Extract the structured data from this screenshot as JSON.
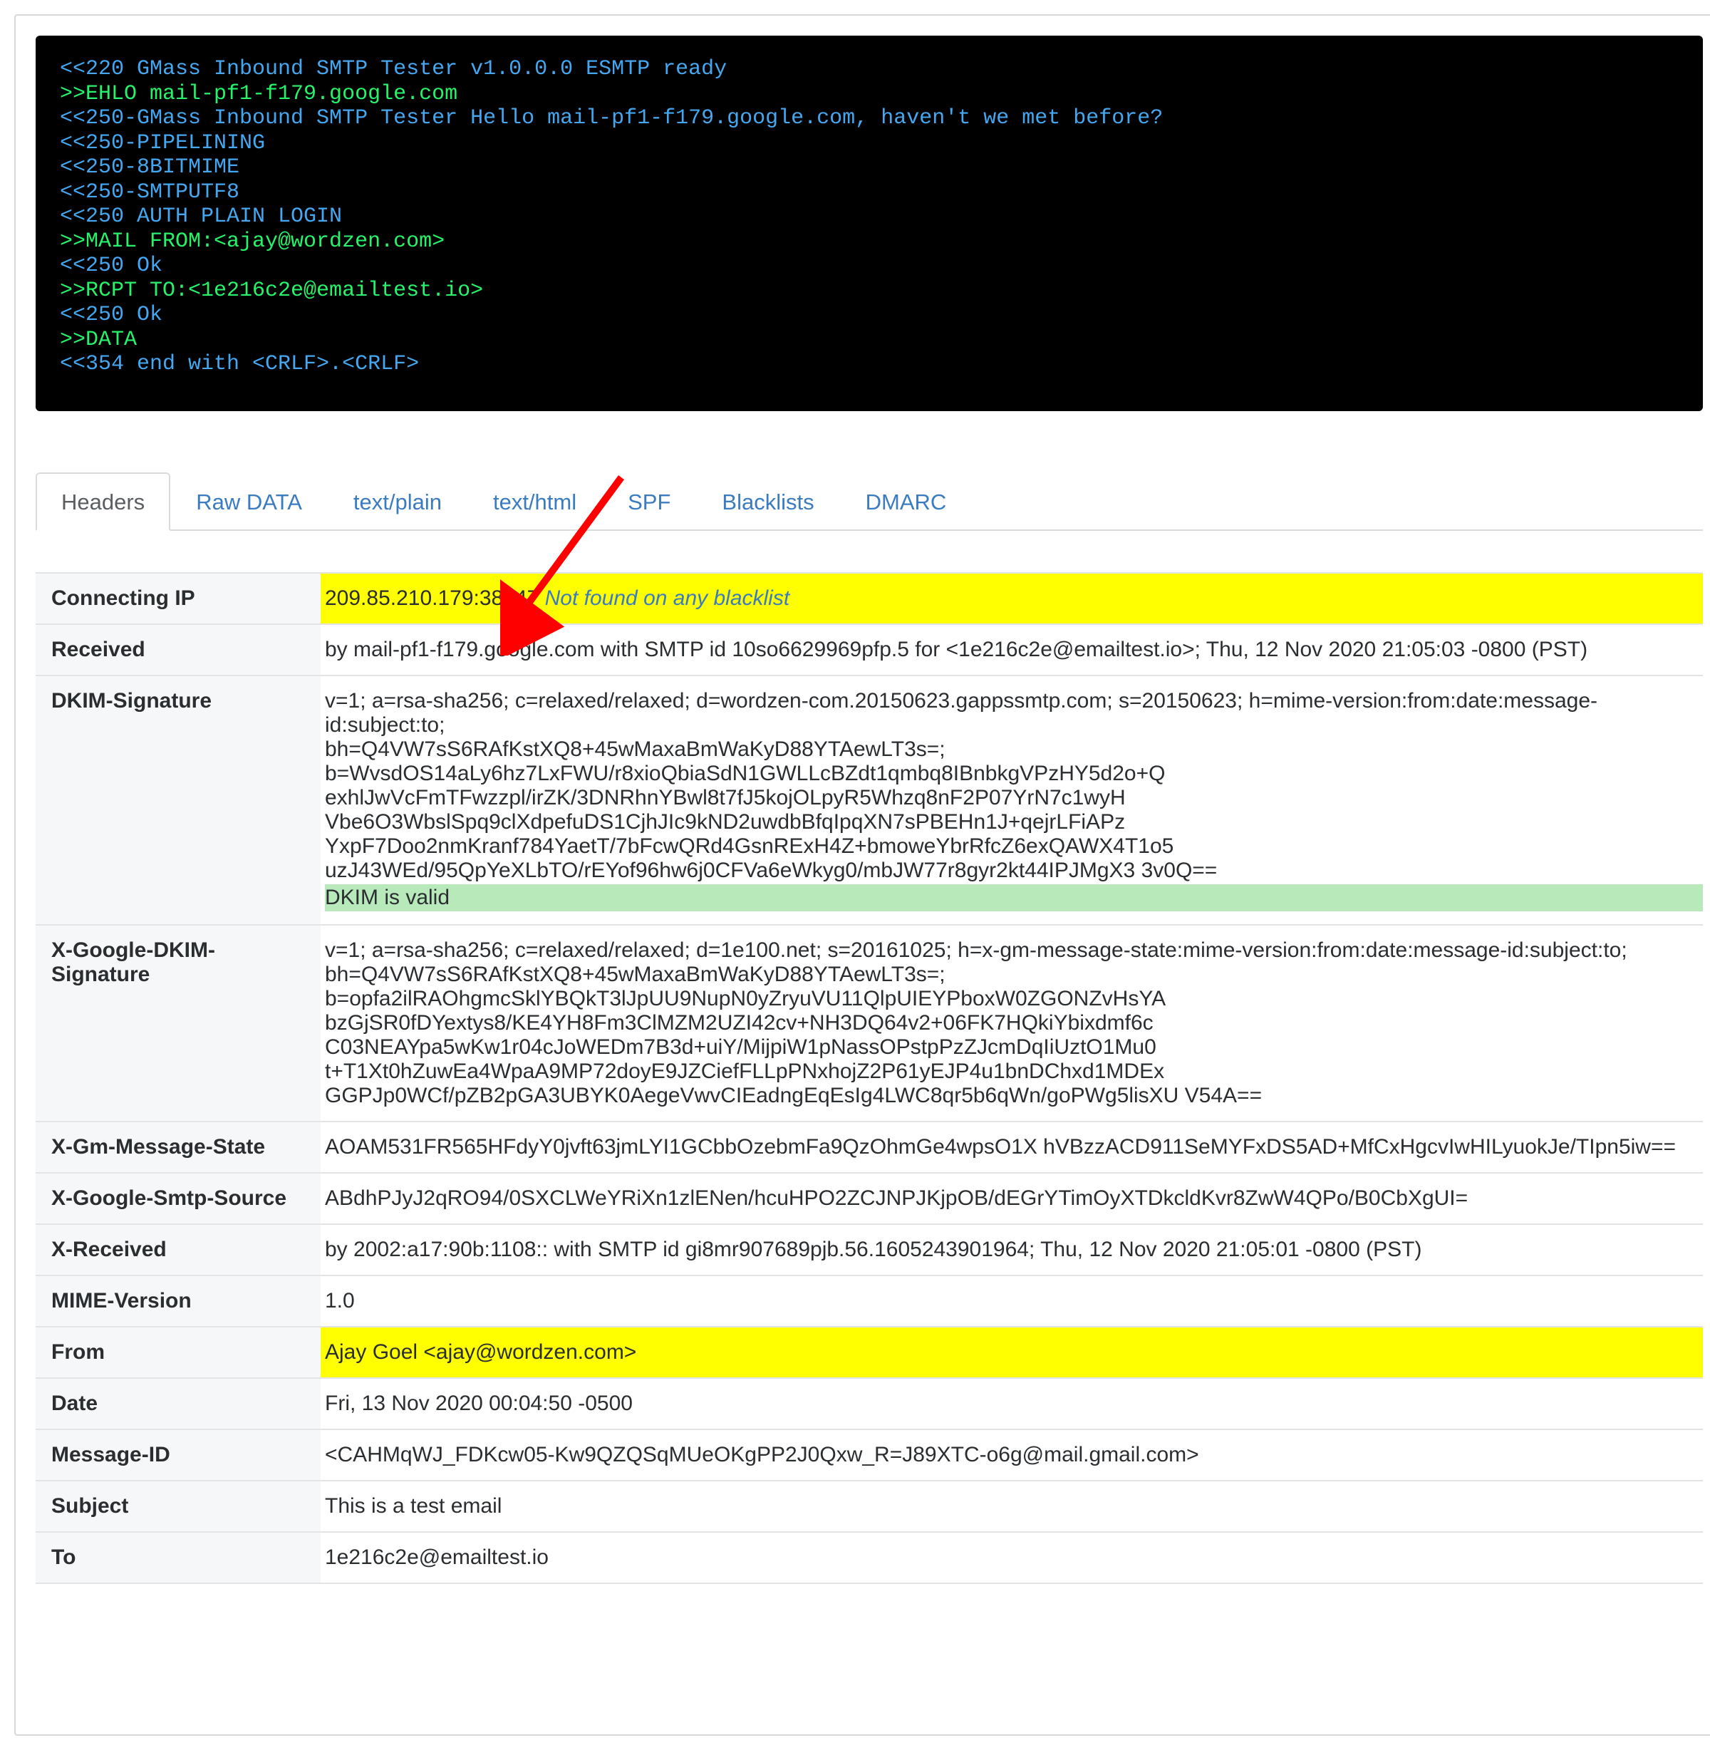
{
  "terminal": {
    "lines": [
      {
        "cls": "c",
        "text": "<<220 GMass Inbound SMTP Tester v1.0.0.0 ESMTP ready"
      },
      {
        "cls": "g",
        "text": ">>EHLO mail-pf1-f179.google.com"
      },
      {
        "cls": "c",
        "text": "<<250-GMass Inbound SMTP Tester Hello mail-pf1-f179.google.com, haven't we met before?"
      },
      {
        "cls": "c",
        "text": "<<250-PIPELINING"
      },
      {
        "cls": "c",
        "text": "<<250-8BITMIME"
      },
      {
        "cls": "c",
        "text": "<<250-SMTPUTF8"
      },
      {
        "cls": "c",
        "text": "<<250 AUTH PLAIN LOGIN"
      },
      {
        "cls": "g",
        "text": ">>MAIL FROM:<ajay@wordzen.com>"
      },
      {
        "cls": "c",
        "text": "<<250 Ok"
      },
      {
        "cls": "g",
        "text": ">>RCPT TO:<1e216c2e@emailtest.io>"
      },
      {
        "cls": "c",
        "text": "<<250 Ok"
      },
      {
        "cls": "g",
        "text": ">>DATA"
      },
      {
        "cls": "c",
        "text": "<<354 end with <CRLF>.<CRLF>"
      }
    ]
  },
  "tabs": {
    "items": [
      {
        "label": "Headers",
        "active": true
      },
      {
        "label": "Raw DATA",
        "active": false
      },
      {
        "label": "text/plain",
        "active": false
      },
      {
        "label": "text/html",
        "active": false
      },
      {
        "label": "SPF",
        "active": false
      },
      {
        "label": "Blacklists",
        "active": false
      },
      {
        "label": "DMARC",
        "active": false
      }
    ]
  },
  "headers": {
    "connecting_ip": {
      "label": "Connecting IP",
      "value": "209.85.210.179:38647",
      "note": "Not found on any blacklist"
    },
    "received": {
      "label": "Received",
      "value": "by mail-pf1-f179.google.com with SMTP id 10so6629969pfp.5 for <1e216c2e@emailtest.io>; Thu, 12 Nov 2020 21:05:03 -0800 (PST)"
    },
    "dkim_signature": {
      "label": "DKIM-Signature",
      "l1": "v=1; a=rsa-sha256; c=relaxed/relaxed; d=wordzen-com.20150623.gappssmtp.com; s=20150623; h=mime-version:from:date:message-id:subject:to;",
      "l2": "bh=Q4VW7sS6RAfKstXQ8+45wMaxaBmWaKyD88YTAewLT3s=;",
      "l3": "b=WvsdOS14aLy6hz7LxFWU/r8xioQbiaSdN1GWLLcBZdt1qmbq8IBnbkgVPzHY5d2o+Q",
      "l4": "exhlJwVcFmTFwzzpl/irZK/3DNRhnYBwl8t7fJ5kojOLpyR5Whzq8nF2P07YrN7c1wyH",
      "l5": "Vbe6O3WbslSpq9clXdpefuDS1CjhJIc9kND2uwdbBfqIpqXN7sPBEHn1J+qejrLFiAPz",
      "l6": "YxpF7Doo2nmKranf784YaetT/7bFcwQRd4GsnRExH4Z+bmoweYbrRfcZ6exQAWX4T1o5",
      "l7": "uzJ43WEd/95QpYeXLbTO/rEYof96hw6j0CFVa6eWkyg0/mbJW77r8gyr2kt44IPJMgX3 3v0Q==",
      "valid": "DKIM is valid"
    },
    "x_google_dkim": {
      "label": "X-Google-DKIM-Signature",
      "l1": "v=1; a=rsa-sha256; c=relaxed/relaxed; d=1e100.net; s=20161025; h=x-gm-message-state:mime-version:from:date:message-id:subject:to;",
      "l2": "bh=Q4VW7sS6RAfKstXQ8+45wMaxaBmWaKyD88YTAewLT3s=;",
      "l3": "b=opfa2ilRAOhgmcSklYBQkT3lJpUU9NupN0yZryuVU11QlpUIEYPboxW0ZGONZvHsYA",
      "l4": "bzGjSR0fDYextys8/KE4YH8Fm3ClMZM2UZI42cv+NH3DQ64v2+06FK7HQkiYbixdmf6c",
      "l5": "C03NEAYpa5wKw1r04cJoWEDm7B3d+uiY/MijpiW1pNassOPstpPzZJcmDqIiUztO1Mu0",
      "l6": "t+T1Xt0hZuwEa4WpaA9MP72doyE9JZCiefFLLpPNxhojZ2P61yEJP4u1bnDChxd1MDEx",
      "l7": "GGPJp0WCf/pZB2pGA3UBYK0AegeVwvCIEadngEqEsIg4LWC8qr5b6qWn/goPWg5lisXU V54A=="
    },
    "x_gm_message_state": {
      "label": "X-Gm-Message-State",
      "value": "AOAM531FR565HFdyY0jvft63jmLYI1GCbbOzebmFa9QzOhmGe4wpsO1X hVBzzACD911SeMYFxDS5AD+MfCxHgcvIwHILyuokJe/TIpn5iw=="
    },
    "x_google_smtp_source": {
      "label": "X-Google-Smtp-Source",
      "value": "ABdhPJyJ2qRO94/0SXCLWeYRiXn1zlENen/hcuHPO2ZCJNPJKjpOB/dEGrYTimOyXTDkcldKvr8ZwW4QPo/B0CbXgUI="
    },
    "x_received": {
      "label": "X-Received",
      "value": "by 2002:a17:90b:1108:: with SMTP id gi8mr907689pjb.56.1605243901964; Thu, 12 Nov 2020 21:05:01 -0800 (PST)"
    },
    "mime_version": {
      "label": "MIME-Version",
      "value": "1.0"
    },
    "from": {
      "label": "From",
      "value": "Ajay Goel <ajay@wordzen.com>"
    },
    "date": {
      "label": "Date",
      "value": "Fri, 13 Nov 2020 00:04:50 -0500"
    },
    "message_id": {
      "label": "Message-ID",
      "value": "<CAHMqWJ_FDKcw05-Kw9QZQSqMUeOKgPP2J0Qxw_R=J89XTC-o6g@mail.gmail.com>"
    },
    "subject": {
      "label": "Subject",
      "value": "This is a test email"
    },
    "to": {
      "label": "To",
      "value": "1e216c2e@emailtest.io"
    }
  }
}
